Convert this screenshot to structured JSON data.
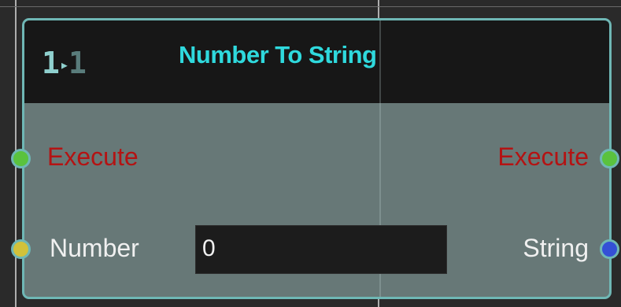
{
  "node": {
    "title": "Number To String",
    "icon": {
      "name": "number-to-string-icon",
      "left_digit": "1",
      "arrow": "▸",
      "right_digit": "1"
    },
    "inputs": [
      {
        "label": "Execute",
        "type": "exec"
      },
      {
        "label": "Number",
        "type": "number",
        "value": "0"
      }
    ],
    "outputs": [
      {
        "label": "Execute",
        "type": "exec"
      },
      {
        "label": "String",
        "type": "string"
      }
    ]
  },
  "colors": {
    "node_border": "#6fb7b5",
    "node_body": "#677877",
    "header": "#171717",
    "title": "#2fd9dd",
    "exec_label": "#b41313",
    "exec_pin": "#5ac23e",
    "number_pin": "#d2c23a",
    "string_pin": "#3450d6"
  }
}
